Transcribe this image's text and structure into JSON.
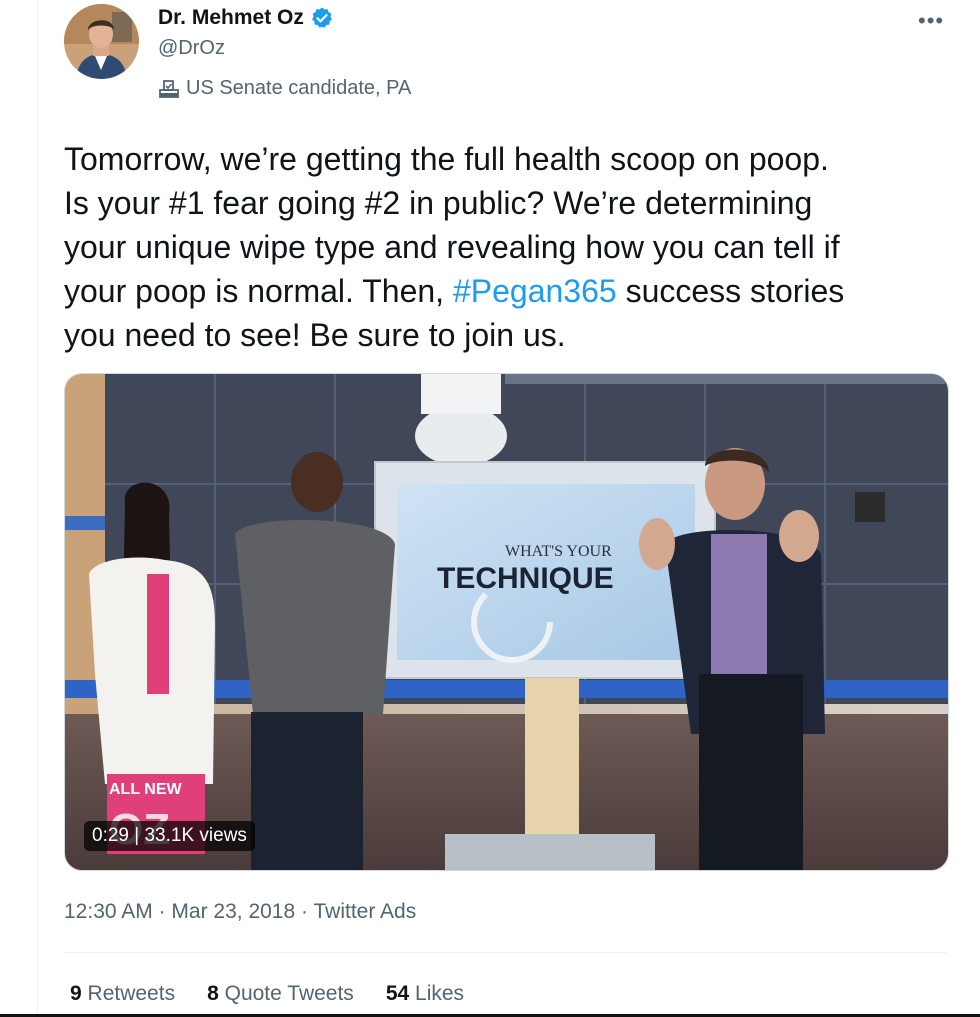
{
  "author": {
    "name": "Dr. Mehmet Oz",
    "handle": "@DrOz",
    "affiliation": "US Senate candidate, PA",
    "verified_color": "#1d9bf0"
  },
  "tweet": {
    "text_before": "Tomorrow, we’re getting the full health scoop on poop.\nIs your #1 fear going #2 in public? We’re determining\nyour unique wipe type and revealing how you can tell if\nyour poop is normal. Then, ",
    "hashtag": "#Pegan365",
    "text_after": " success stories\nyou need to see! Be sure to join us."
  },
  "media": {
    "duration": "0:29",
    "views": "33.1K views",
    "screen_text_top": "WHAT'S YOUR",
    "screen_text_main": "TECHNIQUE",
    "logo_text_1": "ALL NEW",
    "logo_text_2": "OZ"
  },
  "meta": {
    "time": "12:30 AM",
    "date": "Mar 23, 2018",
    "source": "Twitter Ads",
    "separator": "·"
  },
  "stats": {
    "retweets_count": "9",
    "retweets_label": "Retweets",
    "quotes_count": "8",
    "quotes_label": "Quote Tweets",
    "likes_count": "54",
    "likes_label": "Likes"
  },
  "icons": {
    "verified": "verified-badge-icon",
    "affiliation": "ballot-box-icon",
    "more": "more-options-icon"
  }
}
